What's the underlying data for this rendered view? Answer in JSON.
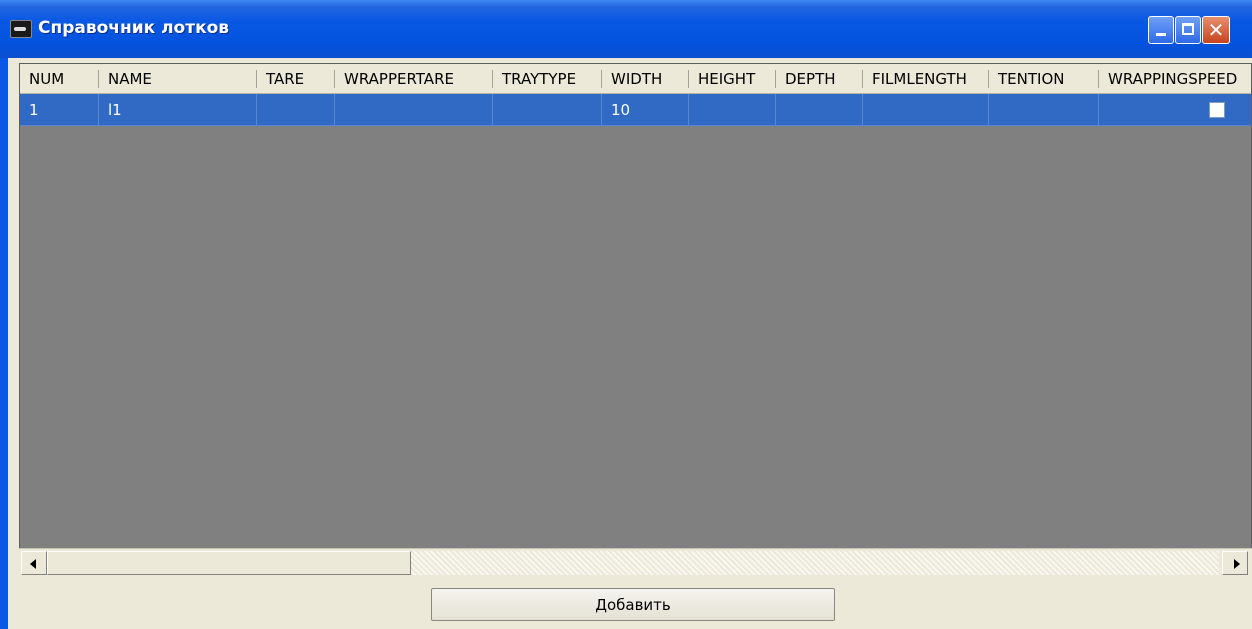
{
  "window": {
    "title": "Справочник лотков",
    "title_bar_color": "#0A58E4",
    "controls": {
      "minimize": "minimize-icon",
      "maximize": "maximize-icon",
      "close": "close-icon"
    }
  },
  "grid": {
    "columns": [
      "NUM",
      "NAME",
      "TARE",
      "WRAPPERTARE",
      "TRAYTYPE",
      "WIDTH",
      "HEIGHT",
      "DEPTH",
      "FILMLENGTH",
      "TENTION",
      "WRAPPINGSPEED"
    ],
    "rows": [
      {
        "NUM": "1",
        "NAME": "l1",
        "TARE": "",
        "WRAPPERTARE": "",
        "TRAYTYPE": "",
        "WIDTH": "10",
        "HEIGHT": "",
        "DEPTH": "",
        "FILMLENGTH": "",
        "TENTION": "",
        "WRAPPINGSPEED": "unchecked",
        "selected": true
      }
    ],
    "selection_color": "#316AC5",
    "empty_area_color": "#808080"
  },
  "buttons": {
    "add_label": "Добавить"
  }
}
